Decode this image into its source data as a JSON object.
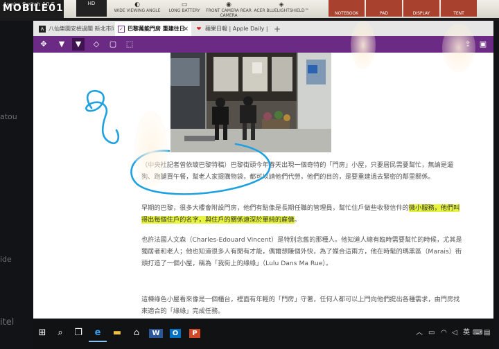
{
  "watermark": "MOBILE01",
  "packaging": {
    "brand": "Aspire Switch 10 E",
    "hd_badge": "HD",
    "features": [
      {
        "label": "WIDE VIEWING ANGLE"
      },
      {
        "label": "LONG BATTERY"
      },
      {
        "label": "FRONT CAMERA REAR CAMERA"
      },
      {
        "label": "ACER BLUELIGHTSHIELD™"
      }
    ],
    "modes": [
      "NOTEBOOK",
      "PAD",
      "DISPLAY",
      "TENT"
    ]
  },
  "bezel": {
    "side_text_top": "atou",
    "side_text_mid": "ide",
    "side_text_bottom": "itel"
  },
  "tabs": [
    {
      "title": "八仙樂園安檢過關 新北市同",
      "icon": "bookmark-icon",
      "active": false
    },
    {
      "title": "巴黎萬能門房 重建往日",
      "icon": "page-icon",
      "active": true
    },
    {
      "title": "蘋果日報 | Apple Daily | 首",
      "icon": "apple-icon",
      "active": false
    }
  ],
  "new_tab_label": "+",
  "toolbar_icons": [
    "pan-icon",
    "pen-icon",
    "highlighter-icon",
    "eraser-icon",
    "comment-icon",
    "clip-icon",
    "share-icon",
    "save-icon"
  ],
  "article": {
    "p1": "（中央社記者曾依璇巴黎特稿）巴黎街頭今年春天出現一個奇特的「門房」小屋，只要居民需要幫忙，無論是遛狗、跑腿買午餐，幫老人家提購物袋，都可以請他們代勞，他們的目的，是要重建過去緊密的鄰里關係。",
    "p2_a": "早期的巴黎，很多大樓會附設門房，他們有點像是長期任職的管理員，幫忙住戶做些收發信件的",
    "p2_hl": "微小服務，他們叫得出每個住戶的名字，與住戶的關係遠深於單純的雇傭",
    "p2_b": "。",
    "p3": "也許法國人文森（Charles-Edouard Vincent）是特別念舊的那種人。他知道人總有臨時需要幫忙的時候，尤其是獨居者和老人；他也知道很多人有閒有才能，偶爾想賺個外快，為了媒合這兩方，他在時髦的瑪黑區（Marais）街頭打造了一個小屋，稱為「我街上的綠綠」（Lulu Dans Ma Rue）。",
    "p4": "這棟綠色小屋看來像是一個櫃台，裡面有年輕的「門房」守著，任何人都可以上門向他們提出各種需求，由門房找來適合的「綠綠」完成任務。"
  },
  "taskbar": {
    "pinned": [
      "windows-start-icon",
      "search-icon",
      "task-view-icon",
      "edge-icon",
      "file-explorer-icon",
      "store-icon",
      "word-icon",
      "outlook-icon",
      "powerpoint-icon"
    ],
    "tray": [
      "chevron-up-icon",
      "battery-icon",
      "network-icon",
      "volume-icon",
      "keyboard-icon",
      "notifications-icon"
    ],
    "ime_label": "英"
  }
}
